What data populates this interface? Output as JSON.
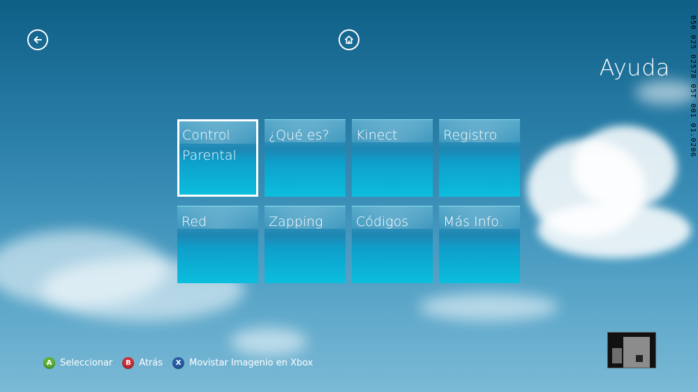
{
  "header": {
    "back_icon": "back-arrow-icon",
    "home_icon": "home-icon",
    "title": "Ayuda"
  },
  "tiles": [
    {
      "label": "Control Parental",
      "selected": true
    },
    {
      "label": "¿Qué es?",
      "selected": false
    },
    {
      "label": "Kinect",
      "selected": false
    },
    {
      "label": "Registro",
      "selected": false
    },
    {
      "label": "Red",
      "selected": false
    },
    {
      "label": "Zapping",
      "selected": false
    },
    {
      "label": "Códigos",
      "selected": false
    },
    {
      "label": "Más Info.",
      "selected": false
    }
  ],
  "legend": [
    {
      "button": "A",
      "color": "#5fb337",
      "label": "Seleccionar"
    },
    {
      "button": "B",
      "color": "#c9323b",
      "label": "Atrás"
    },
    {
      "button": "X",
      "color": "#2b5fa8",
      "label": "Movistar Imagenio en Xbox"
    }
  ],
  "debug_code": "050 025 02578 05T 001 01.0206",
  "colors": {
    "accent": "#0cbedd",
    "sky_top": "#0f5f86"
  }
}
